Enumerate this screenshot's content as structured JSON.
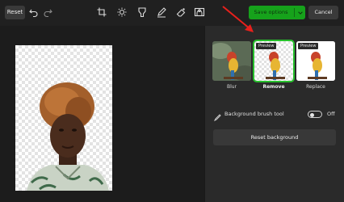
{
  "toolbar": {
    "reset_label": "Reset",
    "save_label": "Save options",
    "cancel_label": "Cancel",
    "icons": [
      "undo-icon",
      "redo-icon",
      "crop-icon",
      "brightness-icon",
      "filter-icon",
      "markup-icon",
      "erase-icon",
      "background-icon"
    ]
  },
  "background_panel": {
    "options": [
      {
        "label": "Blur",
        "badge": ""
      },
      {
        "label": "Remove",
        "badge": "Preview"
      },
      {
        "label": "Replace",
        "badge": "Preview"
      }
    ],
    "selected": "Remove",
    "brush_tool_label": "Background brush tool",
    "brush_toggle_state": "Off",
    "reset_background_label": "Reset background"
  },
  "colors": {
    "accent": "#16a21b",
    "annotation_arrow": "#e8201c"
  }
}
